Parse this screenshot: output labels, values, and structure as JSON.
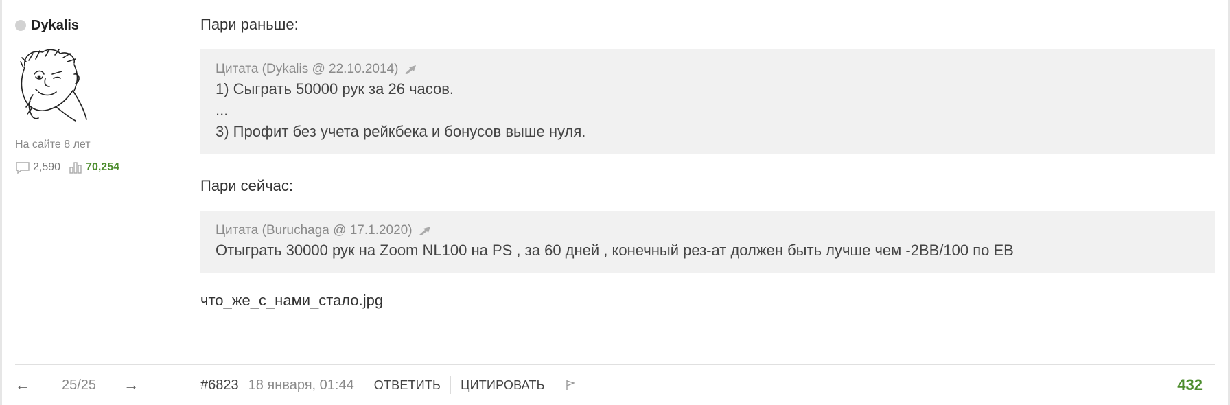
{
  "user": {
    "name": "Dykalis",
    "on_site": "На сайте 8 лет",
    "messages": "2,590",
    "rating": "70,254"
  },
  "post": {
    "intro_before": "Пари раньше:",
    "quote1": {
      "header": "Цитата (Dykalis @ 22.10.2014)",
      "lines": [
        "1) Сыграть 50000 рук за 26 часов.",
        "...",
        "3) Профит без учета рейкбека и бонусов выше нуля."
      ]
    },
    "intro_now": "Пари сейчас:",
    "quote2": {
      "header": "Цитата (Buruchaga @ 17.1.2020)",
      "lines": [
        "Отыграть 30000 рук на Zoom NL100 на PS , за 60 дней , конечный рез-ат должен быть лучше чем -2BB/100 по EB"
      ]
    },
    "file_text": "что_же_с_нами_стало.jpg"
  },
  "footer": {
    "prev_arrow": "←",
    "next_arrow": "→",
    "page": "25/25",
    "post_number": "#6823",
    "date": "18 января, 01:44",
    "reply_label": "ОТВЕТИТЬ",
    "quote_label": "ЦИТИРОВАТЬ",
    "score": "432"
  },
  "colors": {
    "accent_green": "#4d8d2e",
    "quote_bg": "#f1f1f1"
  }
}
